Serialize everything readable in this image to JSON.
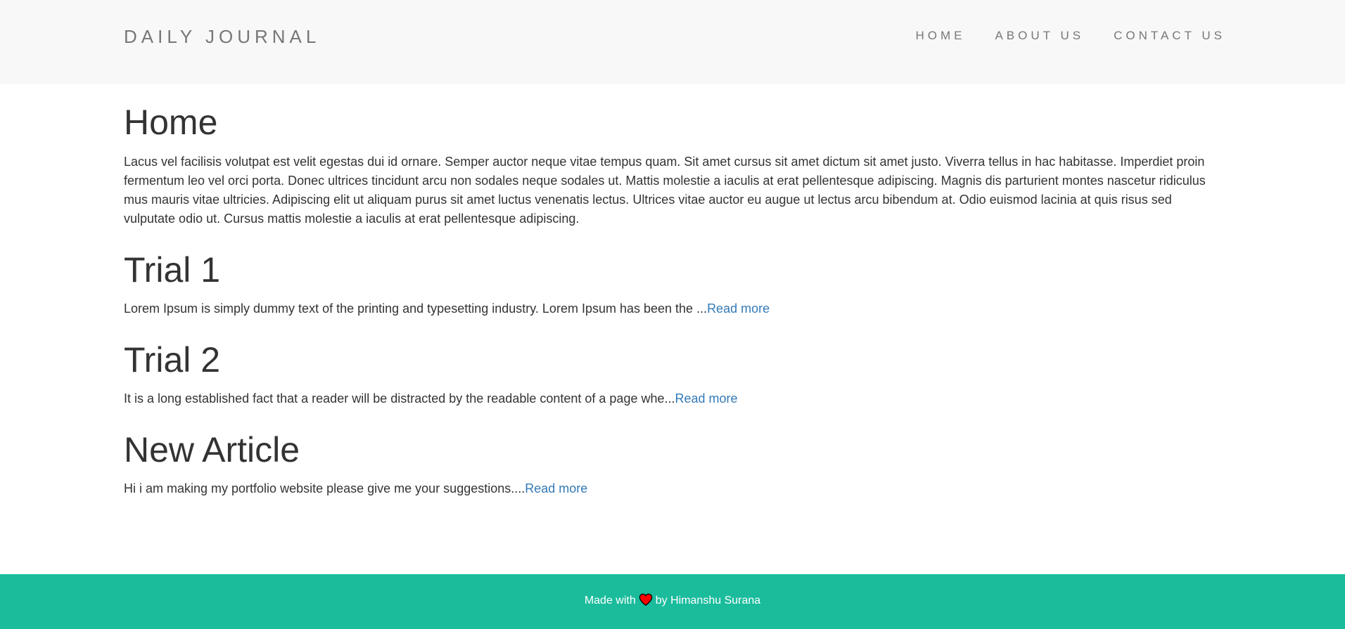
{
  "navbar": {
    "brand": "DAILY JOURNAL",
    "links": [
      {
        "label": "HOME"
      },
      {
        "label": "ABOUT US"
      },
      {
        "label": "CONTACT US"
      }
    ]
  },
  "home": {
    "title": "Home",
    "body": "Lacus vel facilisis volutpat est velit egestas dui id ornare. Semper auctor neque vitae tempus quam. Sit amet cursus sit amet dictum sit amet justo. Viverra tellus in hac habitasse. Imperdiet proin fermentum leo vel orci porta. Donec ultrices tincidunt arcu non sodales neque sodales ut. Mattis molestie a iaculis at erat pellentesque adipiscing. Magnis dis parturient montes nascetur ridiculus mus mauris vitae ultricies. Adipiscing elit ut aliquam purus sit amet luctus venenatis lectus. Ultrices vitae auctor eu augue ut lectus arcu bibendum at. Odio euismod lacinia at quis risus sed vulputate odio ut. Cursus mattis molestie a iaculis at erat pellentesque adipiscing."
  },
  "articles": [
    {
      "title": "Trial 1",
      "excerpt": "Lorem Ipsum is simply dummy text of the printing and typesetting industry. Lorem Ipsum has been the ...",
      "read_more": "Read more"
    },
    {
      "title": "Trial 2",
      "excerpt": "It is a long established fact that a reader will be distracted by the readable content of a page whe...",
      "read_more": "Read more"
    },
    {
      "title": "New Article",
      "excerpt": "Hi i am making my portfolio website please give me your suggestions....",
      "read_more": "Read more"
    }
  ],
  "footer": {
    "prefix": "Made with",
    "icon": "heart-icon",
    "suffix": "by Himanshu Surana"
  },
  "colors": {
    "navbar_bg": "#f8f8f8",
    "nav_text": "#777777",
    "body_text": "#333333",
    "link": "#337ab7",
    "footer_bg": "#1abc9c",
    "heart": "#ff0000"
  }
}
